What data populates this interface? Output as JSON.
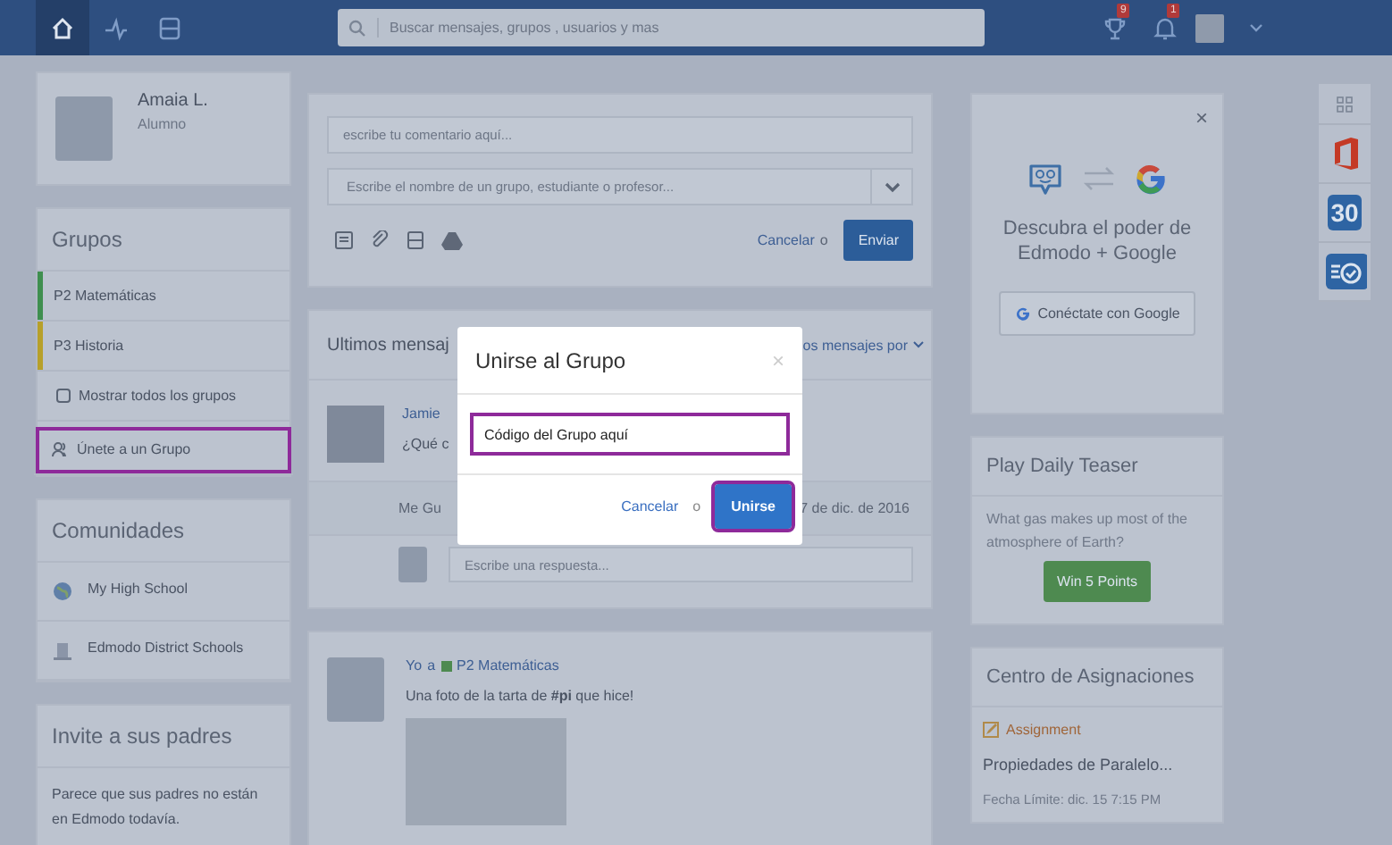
{
  "topbar": {
    "search_placeholder": "Buscar mensajes, grupos , usuarios y mas",
    "badges": [
      {
        "kind": "trophy",
        "count": "9"
      },
      {
        "kind": "bell",
        "count": "1"
      }
    ]
  },
  "profile": {
    "name": "Amaia L.",
    "role": "Alumno"
  },
  "groups": {
    "title": "Grupos",
    "items": [
      {
        "label": "P2 Matemáticas",
        "color": "#3f8f4f"
      },
      {
        "label": "P3 Historia",
        "color": "#b7a02a"
      }
    ],
    "actions": [
      {
        "kind": "show_all",
        "label": "Mostrar todos los grupos",
        "highlighted": false
      },
      {
        "kind": "join",
        "label": "Únete a un Grupo",
        "highlighted": true
      }
    ]
  },
  "communities": {
    "title": "Comunidades",
    "items": [
      "My High School",
      "Edmodo District Schools"
    ]
  },
  "invite": {
    "title": "Invite a sus padres",
    "text": "Parece que sus padres no están en Edmodo todavía."
  },
  "composer": {
    "comment_placeholder": "escribe tu comentario aquí...",
    "recipient_placeholder": "Escribe el nombre de un grupo, estudiante o profesor...",
    "cancel": "Cancelar",
    "or": "o",
    "send": "Enviar"
  },
  "messages": {
    "title": "Ultimos mensaj",
    "filter": "os mensajes por",
    "post": {
      "author": "Jamie",
      "text": "¿Qué c",
      "like": "Me Gu",
      "date": "7 de dic. de 2016",
      "reply_placeholder": "Escribe una respuesta..."
    }
  },
  "post2": {
    "author": "Yo",
    "to": "a",
    "group": "P2 Matemáticas",
    "text": "Una foto de la tarta de **#pi** que hice!"
  },
  "google_card": {
    "close": "×",
    "text": "Descubra el poder de Edmodo + Google",
    "button": "Conéctate con Google"
  },
  "teaser": {
    "title": "Play Daily Teaser",
    "question": "What gas makes up most of the atmosphere of Earth?",
    "button": "Win 5 Points"
  },
  "assignments": {
    "title": "Centro de Asignaciones",
    "type": "Assignment",
    "name": "Propiedades de Paralelo...",
    "due": "Fecha Límite: dic. 15 7:15 PM"
  },
  "apps": {
    "calendar_day": "30"
  },
  "modal": {
    "title": "Unirse al Grupo",
    "close": "×",
    "code_value": "Código del Grupo aquí",
    "code_highlighted": true,
    "cancel": "Cancelar",
    "or": "o",
    "join": "Unirse",
    "join_highlighted": true
  }
}
